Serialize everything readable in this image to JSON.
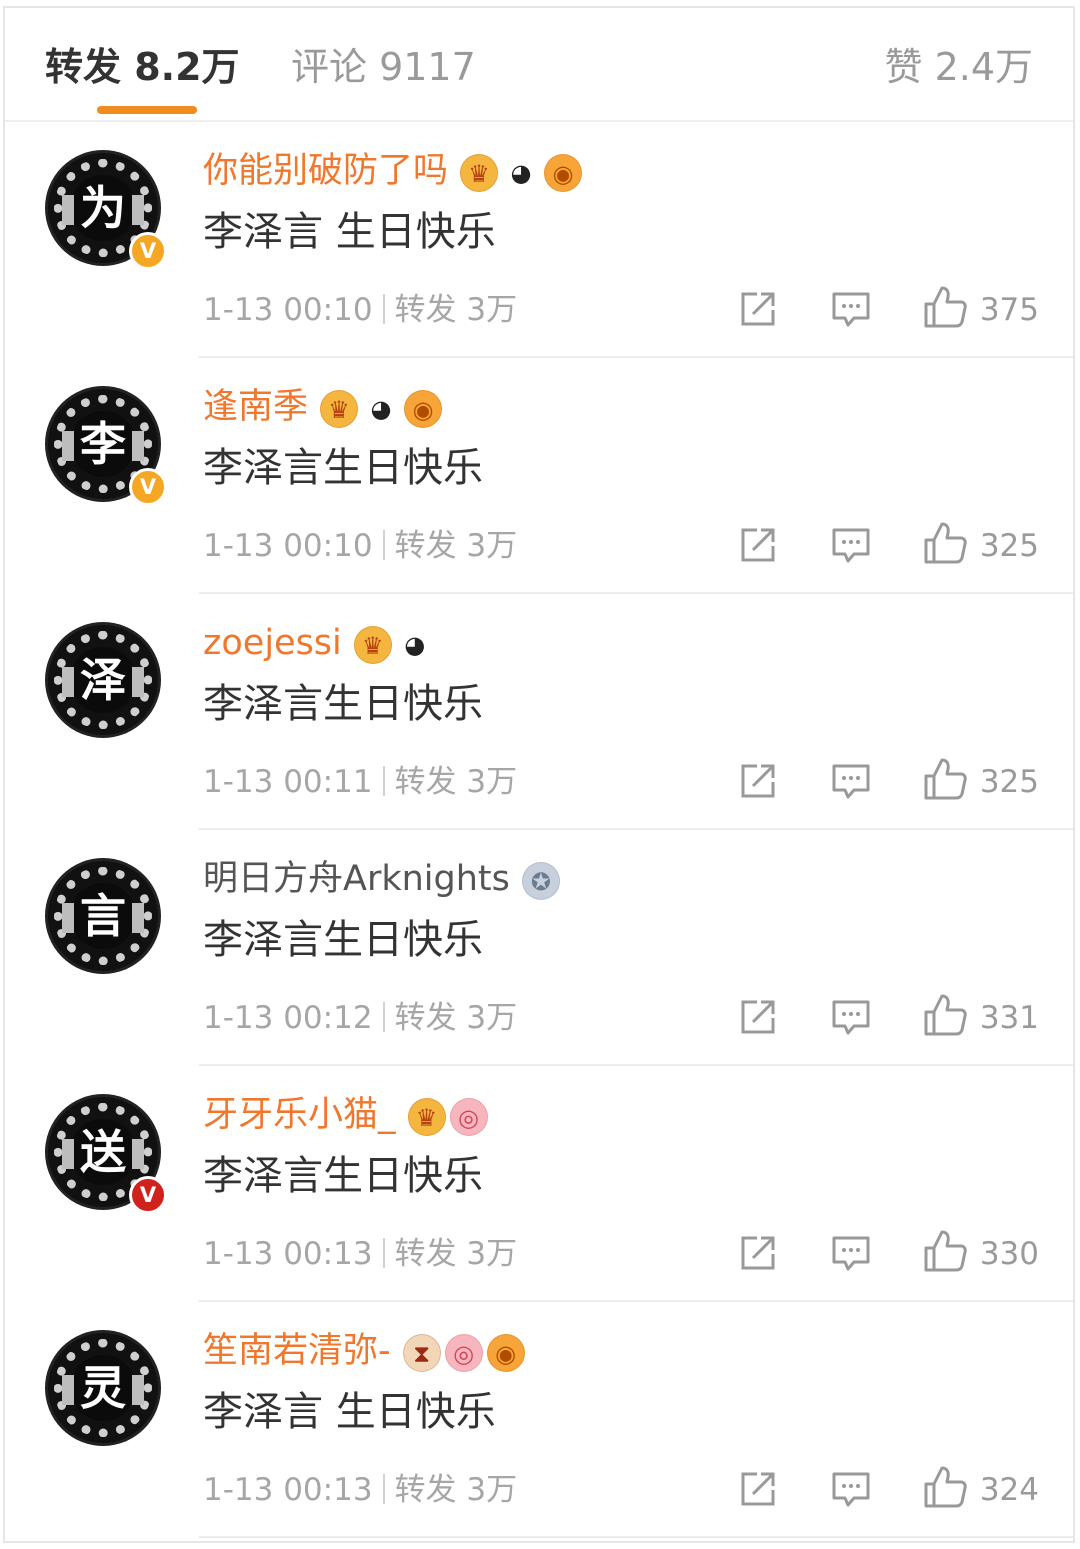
{
  "tabs": {
    "repost_label": "转发 8.2万",
    "comment_label": "评论 9117",
    "like_label": "赞 2.4万"
  },
  "colors": {
    "accent": "#f08c1e",
    "username_orange": "#f0772c",
    "username_normal": "#555555",
    "badge_yellow": "#f5a623",
    "badge_red": "#d0221c"
  },
  "comments": [
    {
      "avatar_char": "为",
      "badge": "V",
      "badge_color": "#f5a623",
      "username": "你能别破防了吗",
      "username_color": "#f0772c",
      "emojis": [
        "crown-icon",
        "panda-icon",
        "pufferfish-icon"
      ],
      "content": "李泽言 生日快乐",
      "time": "1-13 00:10",
      "repost": "转发 3万",
      "likes": "375"
    },
    {
      "avatar_char": "李",
      "badge": "V",
      "badge_color": "#f5a623",
      "username": "逢南季",
      "username_color": "#f0772c",
      "emojis": [
        "crown-icon",
        "panda-icon",
        "pufferfish-icon"
      ],
      "content": "李泽言生日快乐",
      "time": "1-13 00:10",
      "repost": "转发 3万",
      "likes": "325"
    },
    {
      "avatar_char": "泽",
      "badge": "",
      "badge_color": "",
      "username": "zoejessi",
      "username_color": "#f0772c",
      "emojis": [
        "crown-icon",
        "panda-icon"
      ],
      "content": "李泽言生日快乐",
      "time": "1-13 00:11",
      "repost": "转发 3万",
      "likes": "325"
    },
    {
      "avatar_char": "言",
      "badge": "",
      "badge_color": "",
      "username": "明日方舟Arknights",
      "username_color": "#555555",
      "emojis": [
        "medal-icon"
      ],
      "content": "李泽言生日快乐",
      "time": "1-13 00:12",
      "repost": "转发 3万",
      "likes": "331"
    },
    {
      "avatar_char": "送",
      "badge": "V",
      "badge_color": "#d0221c",
      "username": "牙牙乐小猫_",
      "username_color": "#f0772c",
      "emojis": [
        "crown-icon",
        "piggy-icon"
      ],
      "content": "李泽言生日快乐",
      "time": "1-13 00:13",
      "repost": "转发 3万",
      "likes": "330"
    },
    {
      "avatar_char": "灵",
      "badge": "",
      "badge_color": "",
      "username": "笙南若清弥-",
      "username_color": "#f0772c",
      "emojis": [
        "hourglass-icon",
        "piggy-icon",
        "pufferfish-icon"
      ],
      "content": "李泽言 生日快乐",
      "time": "1-13 00:13",
      "repost": "转发 3万",
      "likes": "324"
    }
  ]
}
